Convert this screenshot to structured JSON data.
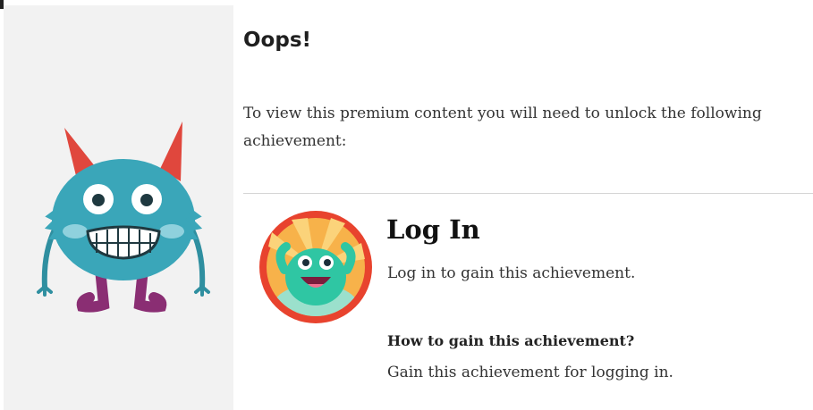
{
  "notice": {
    "title": "Oops!",
    "message": "To view this premium content you will need to unlock the following achievement:"
  },
  "achievement": {
    "name": "Log In",
    "description": "Log in to gain this achievement.",
    "how_to_label": "How to gain this achievement?",
    "how_to_text": "Gain this achievement for logging in.",
    "badge_icon": "smiling-monster-badge-icon"
  },
  "illustration": {
    "icon": "horned-monster-icon"
  },
  "colors": {
    "panel_bg": "#f2f2f2",
    "monster_body": "#3aa6b9",
    "horns": "#e0473d",
    "feet": "#8a2e73",
    "badge_ring": "#e8432e",
    "badge_bg": "#f7b24a",
    "badge_monster": "#2fc6a3"
  }
}
